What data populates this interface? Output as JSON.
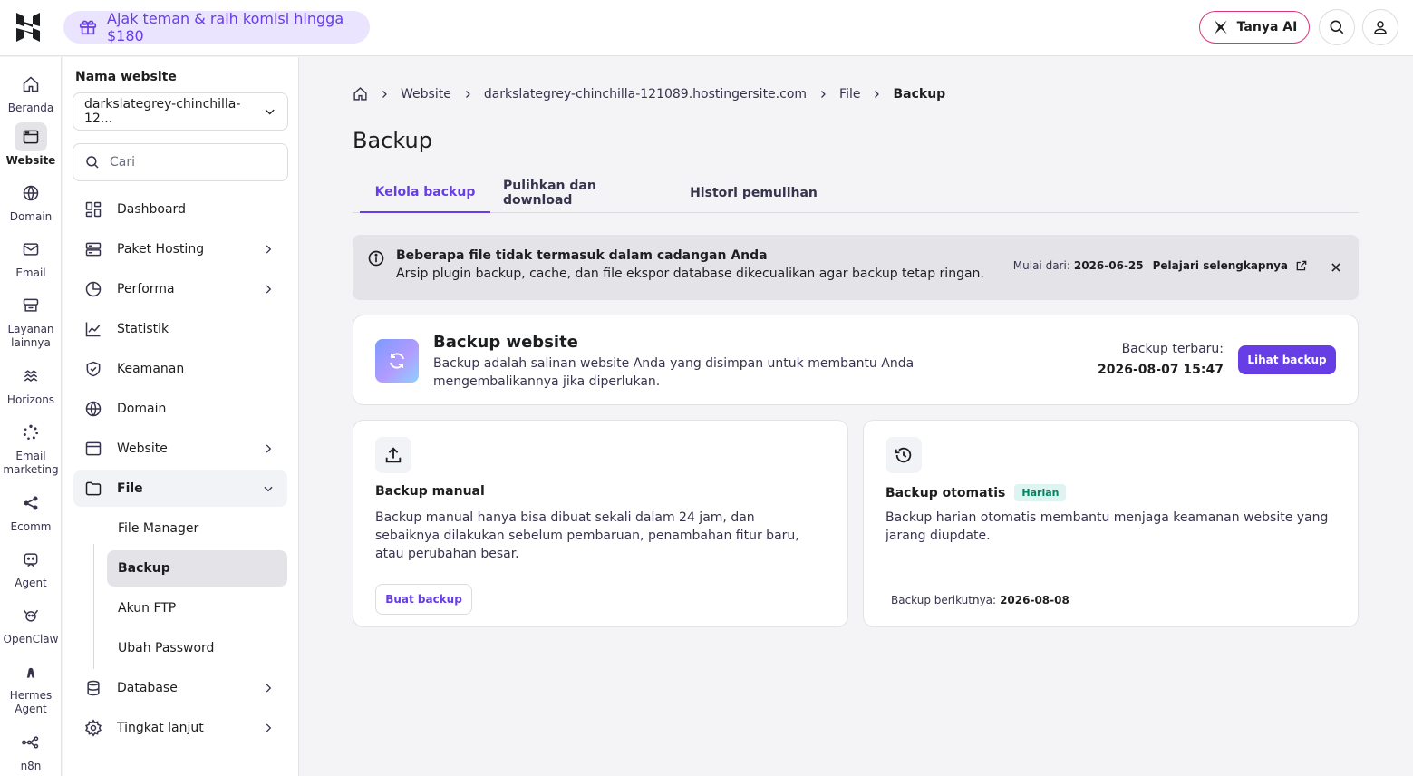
{
  "topbar": {
    "promo_text": "Ajak teman & raih komisi hingga $180",
    "ask_ai_label": "Tanya AI"
  },
  "rail": {
    "items": [
      {
        "label": "Beranda",
        "icon": "home-icon"
      },
      {
        "label": "Website",
        "icon": "browser-icon",
        "active": true
      },
      {
        "label": "Domain",
        "icon": "globe-icon"
      },
      {
        "label": "Email",
        "icon": "mail-icon"
      },
      {
        "label": "Layanan lainnya",
        "icon": "services-icon"
      },
      {
        "label": "Horizons",
        "icon": "horizons-icon"
      },
      {
        "label": "Email marketing",
        "icon": "email-marketing-icon"
      },
      {
        "label": "Ecomm",
        "icon": "ecomm-icon"
      },
      {
        "label": "Agent",
        "icon": "agent-icon"
      },
      {
        "label": "OpenClaw",
        "icon": "openclaw-icon"
      },
      {
        "label": "Hermes Agent",
        "icon": "hermes-icon"
      },
      {
        "label": "n8n",
        "icon": "n8n-icon"
      }
    ]
  },
  "sidebar": {
    "title": "Nama website",
    "selected_site": "darkslategrey-chinchilla-12...",
    "search_placeholder": "Cari",
    "items": [
      {
        "label": "Dashboard",
        "icon": "dashboard-icon"
      },
      {
        "label": "Paket Hosting",
        "icon": "server-icon"
      },
      {
        "label": "Performa",
        "icon": "performance-icon"
      },
      {
        "label": "Statistik",
        "icon": "chart-icon"
      },
      {
        "label": "Keamanan",
        "icon": "shield-icon"
      },
      {
        "label": "Domain",
        "icon": "globe-icon"
      },
      {
        "label": "Website",
        "icon": "browser-icon"
      },
      {
        "label": "File",
        "icon": "folder-icon"
      },
      {
        "label": "Database",
        "icon": "database-icon"
      },
      {
        "label": "Tingkat lanjut",
        "icon": "gear-icon"
      }
    ],
    "file_subitems": [
      "File Manager",
      "Backup",
      "Akun FTP",
      "Ubah Password"
    ]
  },
  "breadcrumb": [
    "Website",
    "darkslategrey-chinchilla-121089.hostingersite.com",
    "File",
    "Backup"
  ],
  "page_title": "Backup",
  "tabs": [
    "Kelola backup",
    "Pulihkan dan download",
    "Histori pemulihan"
  ],
  "notice": {
    "title": "Beberapa file tidak termasuk dalam cadangan Anda",
    "text": "Arsip plugin backup, cache, dan file ekspor database dikecualikan agar backup tetap ringan.",
    "start_label": "Mulai dari:",
    "start_date": "2026-06-25",
    "learn_more": "Pelajari selengkapnya"
  },
  "backup_website": {
    "title": "Backup website",
    "description": "Backup adalah salinan website Anda yang disimpan untuk membantu Anda mengembalikannya jika diperlukan.",
    "latest_label": "Backup terbaru:",
    "latest_value": "2026-08-07 15:47",
    "view_button": "Lihat backup"
  },
  "manual_backup": {
    "title": "Backup manual",
    "description": "Backup manual hanya bisa dibuat sekali dalam 24 jam, dan sebaiknya dilakukan sebelum pembaruan, penambahan fitur baru, atau perubahan besar.",
    "button": "Buat backup"
  },
  "auto_backup": {
    "title": "Backup otomatis",
    "badge": "Harian",
    "description": "Backup harian otomatis membantu menjaga keamanan website yang jarang diupdate.",
    "next_label": "Backup berikutnya:",
    "next_date": "2026-08-08"
  },
  "colors": {
    "accent": "#673de6",
    "badge_green": "#008361",
    "ai_border": "#d9357a"
  }
}
